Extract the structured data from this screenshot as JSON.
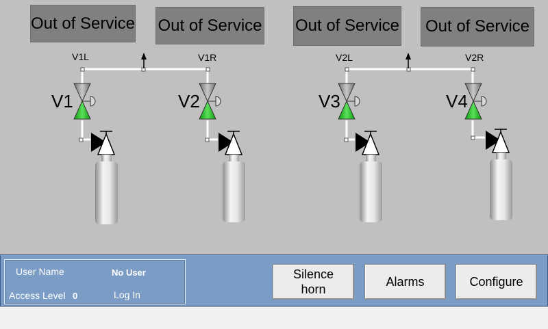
{
  "status_boxes": [
    "Out of Service",
    "Out of Service",
    "Out of Service",
    "Out of Service"
  ],
  "valves": [
    {
      "name": "V1",
      "tag": "V1L"
    },
    {
      "name": "V2",
      "tag": "V1R"
    },
    {
      "name": "V3",
      "tag": "V2L"
    },
    {
      "name": "V4",
      "tag": "V2R"
    }
  ],
  "user_panel": {
    "user_name_label": "User Name",
    "user_name_value": "No User",
    "access_level_label": "Access Level",
    "access_level_value": "0",
    "login_label": "Log In"
  },
  "buttons": {
    "silence_horn": "Silence\nhorn",
    "alarms": "Alarms",
    "configure": "Configure"
  },
  "colors": {
    "background": "#c0c0c0",
    "status_box": "#808080",
    "panel": "#7b9cc4",
    "valve_open": "#22c322",
    "valve_closed": "#8a8a8a"
  },
  "icons": [
    "valve-icon",
    "regulator-icon",
    "gas-cylinder-icon",
    "vent-arrow-icon"
  ]
}
